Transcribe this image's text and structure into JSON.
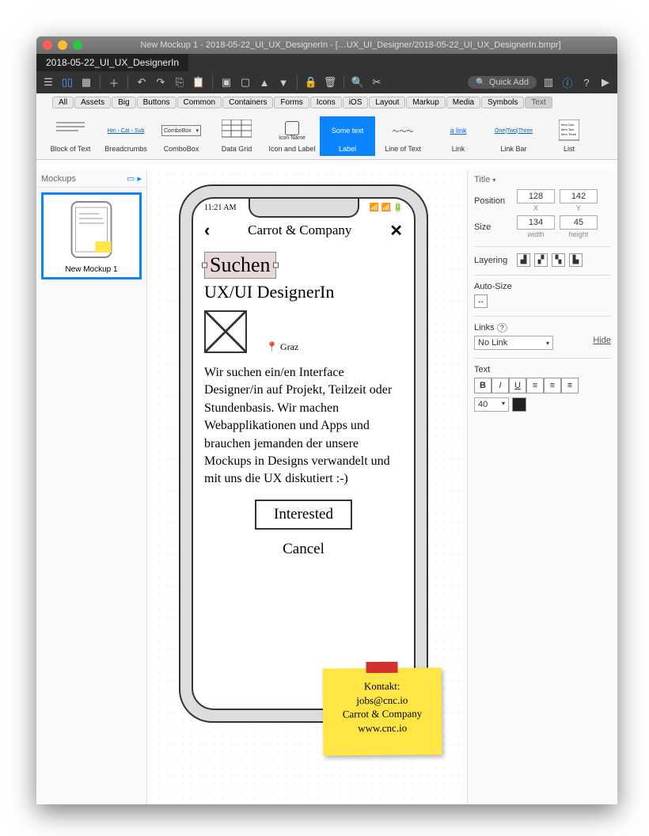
{
  "window": {
    "title": "New Mockup 1 - 2018-05-22_UI_UX_DesignerIn - […UX_UI_Designer/2018-05-22_UI_UX_DesignerIn.bmpr]",
    "tab": "2018-05-22_UI_UX_DesignerIn"
  },
  "toolbar": {
    "quick_add": "Quick Add"
  },
  "categories": [
    "All",
    "Assets",
    "Big",
    "Buttons",
    "Common",
    "Containers",
    "Forms",
    "Icons",
    "iOS",
    "Layout",
    "Markup",
    "Media",
    "Symbols",
    "Text"
  ],
  "active_category": "Text",
  "widgets": [
    {
      "name": "Block of Text"
    },
    {
      "name": "Breadcrumbs"
    },
    {
      "name": "ComboBox"
    },
    {
      "name": "Data Grid"
    },
    {
      "name": "Icon and Label",
      "sub": "Icon Name"
    },
    {
      "name": "Label",
      "selected": true,
      "sub": "Some text"
    },
    {
      "name": "Line of Text"
    },
    {
      "name": "Link",
      "sub": "a link"
    },
    {
      "name": "Link Bar"
    },
    {
      "name": "List"
    }
  ],
  "left": {
    "heading": "Mockups",
    "thumb_label": "New Mockup 1"
  },
  "mockup": {
    "time": "11:21 AM",
    "nav_title": "Carrot & Company",
    "selected_text": "Suchen",
    "heading": "UX/UI DesignerIn",
    "location": "Graz",
    "body": "Wir suchen ein/en Interface Designer/in auf Projekt, Teilzeit oder Stundenbasis. Wir machen Webapplikationen und Apps und brauchen jemanden der unsere Mockups in Designs verwandelt und mit uns die UX diskutiert :-)",
    "button": "Interested",
    "cancel": "Cancel"
  },
  "sticky": {
    "line1": "Kontakt:",
    "line2": "jobs@cnc.io",
    "line3": "Carrot & Company",
    "line4": "www.cnc.io"
  },
  "props": {
    "title_heading": "Title",
    "position_label": "Position",
    "pos_x": "128",
    "pos_y": "142",
    "xlab": "X",
    "ylab": "Y",
    "size_label": "Size",
    "size_w": "134",
    "size_h": "45",
    "wlab": "width",
    "hlab": "height",
    "layering_label": "Layering",
    "autosize_label": "Auto-Size",
    "links_label": "Links",
    "links_value": "No Link",
    "hide": "Hide",
    "text_label": "Text",
    "font_size": "40",
    "b": "B",
    "i": "I",
    "u": "U"
  }
}
